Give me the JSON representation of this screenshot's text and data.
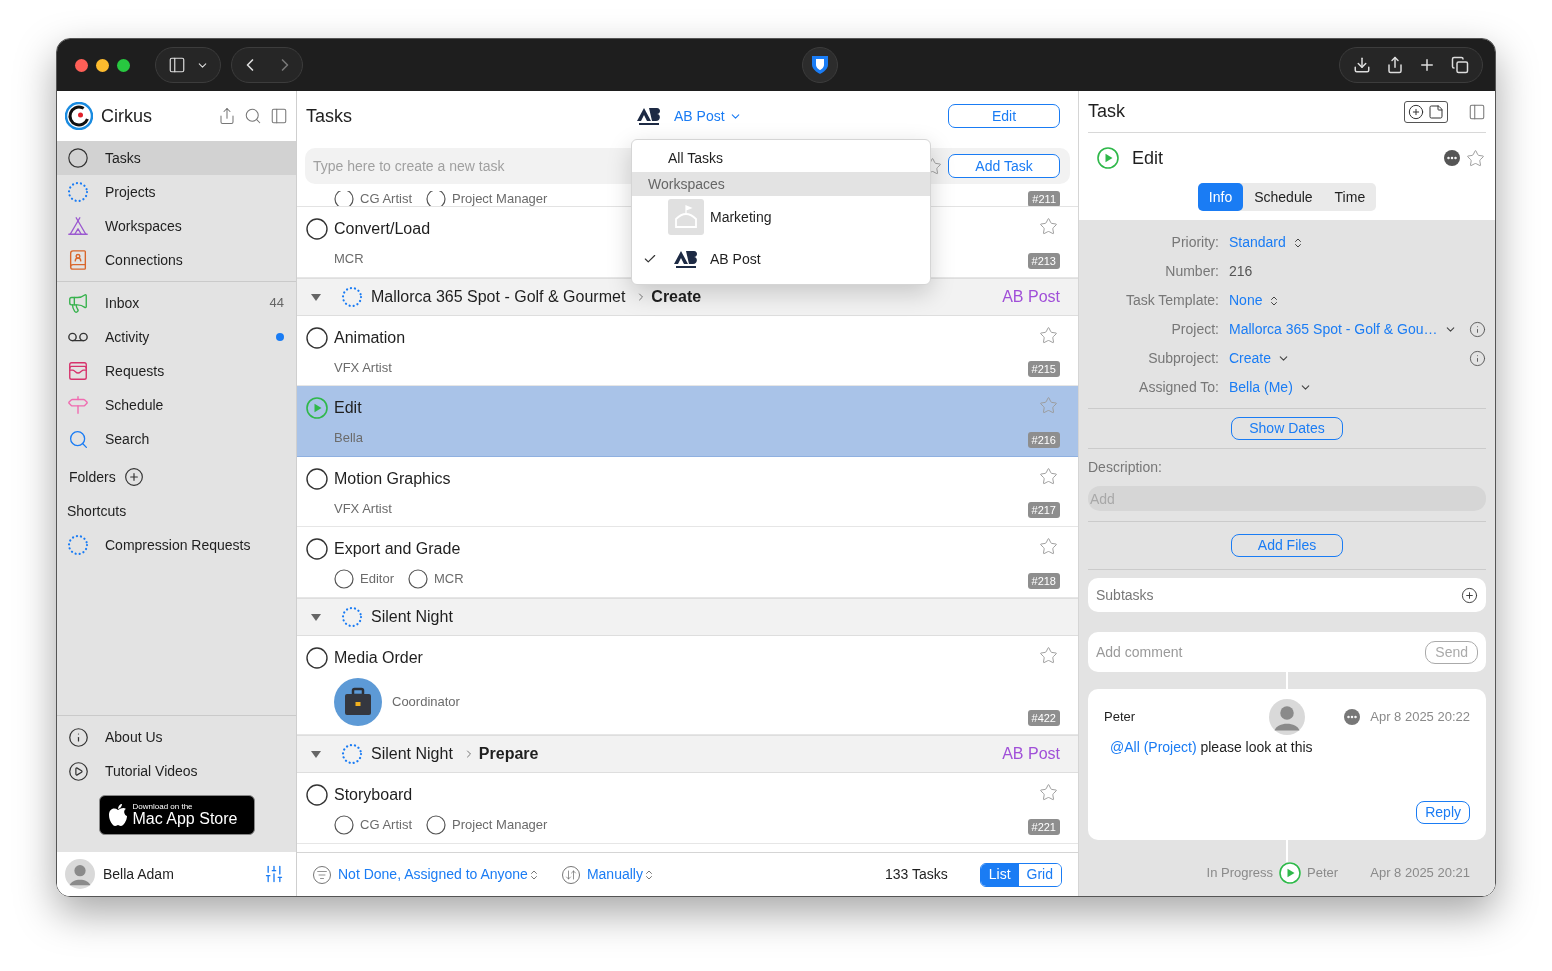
{
  "sidebar": {
    "app_name": "Cirkus",
    "nav": [
      {
        "label": "Tasks",
        "selected": true
      },
      {
        "label": "Projects",
        "selected": false
      },
      {
        "label": "Workspaces",
        "selected": false
      },
      {
        "label": "Connections",
        "selected": false
      }
    ],
    "views": [
      {
        "label": "Inbox",
        "selected": false,
        "count": "44",
        "unread": false
      },
      {
        "label": "Activity",
        "selected": false,
        "unread": true
      },
      {
        "label": "Requests",
        "selected": false,
        "unread": false
      },
      {
        "label": "Schedule",
        "selected": false,
        "unread": false
      },
      {
        "label": "Search",
        "selected": false,
        "unread": false
      }
    ],
    "folders_label": "Folders",
    "shortcuts_label": "Shortcuts",
    "shortcuts": [
      {
        "label": "Compression Requests",
        "selected": false
      }
    ],
    "footer_links": [
      {
        "label": "About Us"
      },
      {
        "label": "Tutorial Videos"
      }
    ],
    "store_badge": {
      "line1": "Download on the",
      "line2": "Mac App Store"
    },
    "user": {
      "name": "Bella Adam"
    }
  },
  "task_list": {
    "title": "Tasks",
    "workspace_filter": "AB Post",
    "edit_button": "Edit",
    "new_task_placeholder": "Type here to create a new task",
    "add_button": "Add Task",
    "rows": [
      {
        "kind": "tail",
        "number": "#211",
        "assignees": [
          {
            "name": "CG Artist",
            "kind": "role"
          },
          {
            "name": "Project Manager",
            "kind": "role"
          }
        ]
      },
      {
        "kind": "task",
        "title": "Convert/Load",
        "started": false,
        "selected": false,
        "starred": false,
        "number": "#213",
        "assignees": [
          {
            "name": "MCR",
            "kind": "text"
          }
        ]
      },
      {
        "kind": "group",
        "project": "Mallorca 365 Spot - Golf & Gourmet",
        "subproject": "Create",
        "workspace": "AB Post",
        "expanded": true
      },
      {
        "kind": "task",
        "title": "Animation",
        "started": false,
        "selected": false,
        "starred": false,
        "number": "#215",
        "assignees": [
          {
            "name": "VFX Artist",
            "kind": "text"
          }
        ]
      },
      {
        "kind": "task",
        "title": "Edit",
        "started": true,
        "selected": true,
        "starred": false,
        "number": "#216",
        "assignees": [
          {
            "name": "Bella",
            "kind": "text"
          }
        ]
      },
      {
        "kind": "task",
        "title": "Motion Graphics",
        "started": false,
        "selected": false,
        "starred": false,
        "number": "#217",
        "assignees": [
          {
            "name": "VFX Artist",
            "kind": "text"
          }
        ]
      },
      {
        "kind": "task",
        "title": "Export and Grade",
        "started": false,
        "selected": false,
        "starred": false,
        "number": "#218",
        "assignees": [
          {
            "name": "Editor",
            "kind": "role"
          },
          {
            "name": "MCR",
            "kind": "role"
          }
        ]
      },
      {
        "kind": "group",
        "project": "Silent Night",
        "expanded": true
      },
      {
        "kind": "task",
        "title": "Media Order",
        "started": false,
        "selected": false,
        "starred": false,
        "number": "#422",
        "assignees": [
          {
            "name": "Coordinator",
            "kind": "avatar"
          }
        ]
      },
      {
        "kind": "group",
        "project": "Silent Night",
        "subproject": "Prepare",
        "workspace": "AB Post",
        "expanded": true
      },
      {
        "kind": "task",
        "title": "Storyboard",
        "started": false,
        "selected": false,
        "starred": false,
        "number": "#221",
        "assignees": [
          {
            "name": "CG Artist",
            "kind": "role"
          },
          {
            "name": "Project Manager",
            "kind": "role"
          }
        ]
      }
    ],
    "filter": "Not Done, Assigned to Anyone",
    "sort": "Manually",
    "count": "133 Tasks",
    "views": [
      {
        "label": "List",
        "selected": true
      },
      {
        "label": "Grid",
        "selected": false
      }
    ]
  },
  "workspace_menu": {
    "items": [
      {
        "kind": "option",
        "label": "All Tasks",
        "checked": false
      },
      {
        "kind": "header",
        "label": "Workspaces"
      },
      {
        "kind": "workspace",
        "label": "Marketing",
        "checked": false
      },
      {
        "kind": "workspace",
        "label": "AB Post",
        "checked": true
      }
    ]
  },
  "task_detail": {
    "title": "Task",
    "task_name": "Edit",
    "started": true,
    "starred": false,
    "tabs": [
      {
        "label": "Info",
        "selected": true
      },
      {
        "label": "Schedule",
        "selected": false
      },
      {
        "label": "Time",
        "selected": false
      }
    ],
    "fields": [
      {
        "label": "Priority:",
        "value": "Standard",
        "kind": "select",
        "info": false
      },
      {
        "label": "Number:",
        "value": "216",
        "kind": "text",
        "info": false
      },
      {
        "label": "Task Template:",
        "value": "None",
        "kind": "select",
        "info": false
      },
      {
        "label": "Project:",
        "value": "Mallorca 365 Spot - Golf & Gou…",
        "kind": "menu",
        "info": true
      },
      {
        "label": "Subproject:",
        "value": "Create",
        "kind": "menu",
        "info": true
      },
      {
        "label": "Assigned To:",
        "value": "Bella (Me)",
        "kind": "menu",
        "info": false
      }
    ],
    "show_dates": "Show Dates",
    "description_label": "Description:",
    "description_placeholder": "Add",
    "add_files": "Add Files",
    "subtasks_label": "Subtasks",
    "comment_placeholder": "Add comment",
    "send": {
      "label": "Send",
      "disabled": true
    },
    "comments": [
      {
        "author": "Peter",
        "time": "Apr 8 2025 20:22",
        "mention": "@All (Project)",
        "text": "please look at this",
        "reply": "Reply"
      }
    ],
    "history": [
      {
        "status": "In Progress",
        "author": "Peter",
        "time": "Apr 8 2025 20:21"
      }
    ]
  }
}
